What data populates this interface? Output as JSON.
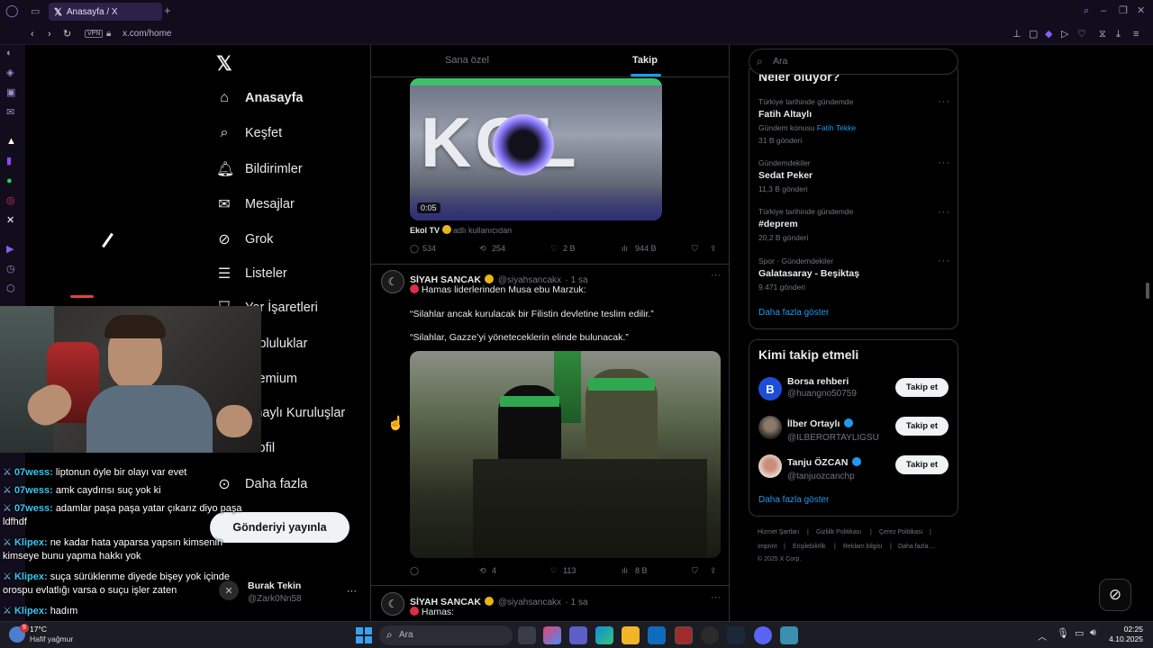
{
  "browser": {
    "tab_title": "Anasayfa / X",
    "vpn_badge": "VPN",
    "url": "x.com/home"
  },
  "nav": {
    "items": [
      {
        "label": "Anasayfa",
        "icon": "home-icon"
      },
      {
        "label": "Keşfet",
        "icon": "search-icon"
      },
      {
        "label": "Bildirimler",
        "icon": "bell-icon"
      },
      {
        "label": "Mesajlar",
        "icon": "mail-icon"
      },
      {
        "label": "Grok",
        "icon": "grok-icon"
      },
      {
        "label": "Listeler",
        "icon": "list-icon"
      },
      {
        "label": "Yer İşaretleri",
        "icon": "bookmark-icon"
      },
      {
        "label": "Topluluklar",
        "icon": "people-icon"
      },
      {
        "label": "Premium",
        "icon": "x-icon"
      },
      {
        "label": "Onaylı Kuruluşlar",
        "icon": "lightning-icon"
      },
      {
        "label": "Profil",
        "icon": "person-icon"
      },
      {
        "label": "Daha fazla",
        "icon": "more-circle-icon"
      }
    ],
    "post_button": "Gönderiyi yayınla",
    "account": {
      "name": "Burak Tekin",
      "handle": "@Zark0Nn58"
    }
  },
  "feed": {
    "tabs": [
      "Sana özel",
      "Takip"
    ],
    "active_tab": "Takip",
    "tweet1": {
      "video_text": "KOL",
      "video_time": "0:05",
      "source_name": "Ekol TV",
      "source_suffix": "adlı kullanıcıdan",
      "replies": "534",
      "retweets": "254",
      "likes": "2 B",
      "views": "944 B"
    },
    "tweet2": {
      "name": "SİYAH SANCAK",
      "handle": "@siyahsancakx",
      "time": "· 1 sa",
      "line1": "Hamas liderlerinden Musa ebu Marzuk:",
      "line2": "“Silahlar ancak kurulacak bir Filistin devletine teslim edilir.”",
      "line3": "“Silahlar, Gazze’yi yöneteceklerin elinde bulunacak.”",
      "replies": "",
      "retweets": "4",
      "likes": "113",
      "views": "8 B"
    },
    "tweet3": {
      "name": "SİYAH SANCAK",
      "handle": "@siyahsancakx",
      "time": "· 1 sa",
      "line1": "Hamas:"
    }
  },
  "right": {
    "search_placeholder": "Ara",
    "trends_heading": "Neler oluyor?",
    "trends": [
      {
        "context": "Türkiye tarihinde gündemde",
        "name": "Fatih Altaylı",
        "extra_prefix": "Gündem konusu",
        "extra_link": "Fatih Tekke",
        "count": "31 B gönderi"
      },
      {
        "context": "Gündemdekiler",
        "name": "Sedat Peker",
        "extra_prefix": "",
        "extra_link": "",
        "count": "11,3 B gönderi"
      },
      {
        "context": "Türkiye tarihinde gündemde",
        "name": "#deprem",
        "extra_prefix": "",
        "extra_link": "",
        "count": "20,2 B gönderi"
      },
      {
        "context": "Spor · Gündemdekiler",
        "name": "Galatasaray - Beşiktaş",
        "extra_prefix": "",
        "extra_link": "",
        "count": "9.471 gönderi"
      }
    ],
    "show_more": "Daha fazla göster",
    "who_to_follow": "Kimi takip etmeli",
    "follow": [
      {
        "name": "Borsa rehberi",
        "handle": "@huangno50759",
        "verified": false,
        "avatar_letter": "B"
      },
      {
        "name": "İlber Ortaylı",
        "handle": "@ILBERORTAYLIGSU",
        "verified": true,
        "avatar_letter": ""
      },
      {
        "name": "Tanju ÖZCAN",
        "handle": "@tanjuozcanchp",
        "verified": true,
        "avatar_letter": ""
      }
    ],
    "follow_button": "Takip et",
    "show_more_2": "Daha fazla göster",
    "footer": {
      "l1": "Hizmet Şartları",
      "l2": "Gizlilik Politikası",
      "l3": "Çerez Politikası",
      "l4": "Imprint",
      "l5": "Erişilebilirlik",
      "l6": "Reklam bilgisi",
      "l7": "Daha fazla ...",
      "copyright": "© 2025 X Corp."
    }
  },
  "chat": [
    {
      "user": "07wess:",
      "msg": "liptonun öyle bir olayı var evet"
    },
    {
      "user": "07wess:",
      "msg": "amk caydırısı suç yok ki"
    },
    {
      "user": "07wess:",
      "msg": "adamlar paşa paşa yatar çıkarız diyo paşa",
      "msg2": "ldfhdf"
    },
    {
      "user": "Klipex:",
      "msg": "ne kadar hata yaparsa yapsın kimsenin",
      "msg2": "kimseye bunu yapma hakkı yok"
    },
    {
      "user": "Klipex:",
      "msg": "suça sürüklenme diyede bişey yok içinde",
      "msg2": "orospu evlatlığı varsa o suçu işler zaten"
    },
    {
      "user": "Klipex:",
      "msg": "hadım"
    }
  ],
  "taskbar": {
    "weather_temp": "17°C",
    "weather_desc": "Hafif yağmur",
    "weather_badge": "9",
    "search_placeholder": "Ara",
    "time": "02:25",
    "date": "4.10.2025"
  }
}
